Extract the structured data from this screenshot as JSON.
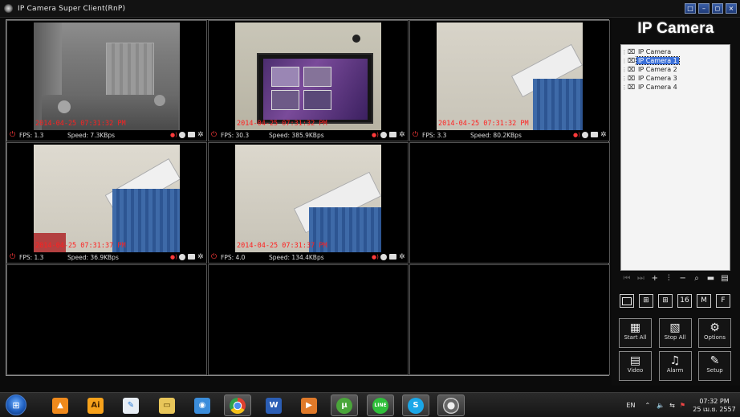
{
  "window": {
    "title": "IP Camera Super Client(RnP)",
    "buttons": [
      "□",
      "–",
      "◻",
      "×"
    ]
  },
  "cameras": [
    {
      "timestamp": "2014-04-25 07:31:32 PM",
      "fps": "FPS: 1.3",
      "speed": "Speed: 7.3KBps",
      "scene": "room"
    },
    {
      "timestamp": "2014-04-25 07:31:32 PM",
      "fps": "FPS: 30.3",
      "speed": "Speed: 385.9KBps",
      "scene": "monitor"
    },
    {
      "timestamp": "2014-04-25 07:31:32 PM",
      "fps": "FPS: 3.3",
      "speed": "Speed: 80.2KBps",
      "scene": "ac"
    },
    {
      "timestamp": "2014-04-25 07:31:37 PM",
      "fps": "FPS: 1.3",
      "speed": "Speed: 36.9KBps",
      "scene": "ac"
    },
    {
      "timestamp": "2014-04-25 07:31:37 PM",
      "fps": "FPS: 4.0",
      "speed": "Speed: 134.4KBps",
      "scene": "ac"
    }
  ],
  "sidebar": {
    "brand": "IP Camera",
    "tree": [
      {
        "label": "IP Camera",
        "selected": false
      },
      {
        "label": "IP Camera 1",
        "selected": true
      },
      {
        "label": "IP Camera 2",
        "selected": false
      },
      {
        "label": "IP Camera 3",
        "selected": false
      },
      {
        "label": "IP Camera 4",
        "selected": false
      }
    ],
    "layout_buttons": [
      "1",
      "4",
      "9",
      "16",
      "M",
      "F"
    ],
    "actions_row1": [
      {
        "label": "Start All",
        "icon": "start-all-icon"
      },
      {
        "label": "Stop All",
        "icon": "stop-all-icon"
      },
      {
        "label": "Options",
        "icon": "options-icon"
      }
    ],
    "actions_row2": [
      {
        "label": "Video",
        "icon": "video-icon"
      },
      {
        "label": "Alarm",
        "icon": "alarm-icon"
      },
      {
        "label": "Setup",
        "icon": "setup-icon"
      }
    ]
  },
  "taskbar": {
    "lang": "EN",
    "time": "07:32 PM",
    "date": "25 เม.ย. 2557"
  }
}
